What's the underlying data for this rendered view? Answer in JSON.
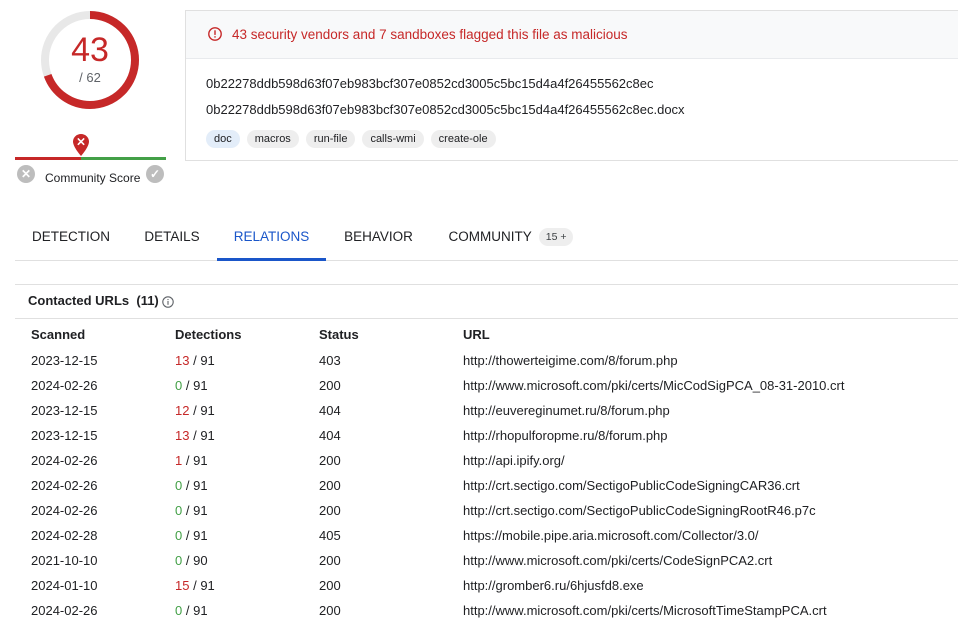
{
  "score": {
    "detections": "43",
    "total": "/ 62"
  },
  "community": {
    "label": "Community Score"
  },
  "summary": {
    "alert": "43 security vendors and 7 sandboxes flagged this file as malicious",
    "hash": "0b22278ddb598d63f07eb983bcf307e0852cd3005c5bc15d4a4f26455562c8ec",
    "filename": "0b22278ddb598d63f07eb983bcf307e0852cd3005c5bc15d4a4f26455562c8ec.docx",
    "tags": [
      "doc",
      "macros",
      "run-file",
      "calls-wmi",
      "create-ole"
    ]
  },
  "tabs": [
    {
      "label": "DETECTION"
    },
    {
      "label": "DETAILS"
    },
    {
      "label": "RELATIONS"
    },
    {
      "label": "BEHAVIOR"
    },
    {
      "label": "COMMUNITY",
      "badge": "15 +"
    }
  ],
  "contacted": {
    "title": "Contacted URLs",
    "count": "(11)",
    "columns": {
      "scanned": "Scanned",
      "detections": "Detections",
      "status": "Status",
      "url": "URL"
    },
    "rows": [
      {
        "scanned": "2023-12-15",
        "det": "13",
        "total": "/ 91",
        "status": "403",
        "url": "http://thowerteigime.com/8/forum.php"
      },
      {
        "scanned": "2024-02-26",
        "det": "0",
        "total": "/ 91",
        "status": "200",
        "url": "http://www.microsoft.com/pki/certs/MicCodSigPCA_08-31-2010.crt"
      },
      {
        "scanned": "2023-12-15",
        "det": "12",
        "total": "/ 91",
        "status": "404",
        "url": "http://euvereginumet.ru/8/forum.php"
      },
      {
        "scanned": "2023-12-15",
        "det": "13",
        "total": "/ 91",
        "status": "404",
        "url": "http://rhopulforopme.ru/8/forum.php"
      },
      {
        "scanned": "2024-02-26",
        "det": "1",
        "total": "/ 91",
        "status": "200",
        "url": "http://api.ipify.org/"
      },
      {
        "scanned": "2024-02-26",
        "det": "0",
        "total": "/ 91",
        "status": "200",
        "url": "http://crt.sectigo.com/SectigoPublicCodeSigningCAR36.crt"
      },
      {
        "scanned": "2024-02-26",
        "det": "0",
        "total": "/ 91",
        "status": "200",
        "url": "http://crt.sectigo.com/SectigoPublicCodeSigningRootR46.p7c"
      },
      {
        "scanned": "2024-02-28",
        "det": "0",
        "total": "/ 91",
        "status": "405",
        "url": "https://mobile.pipe.aria.microsoft.com/Collector/3.0/"
      },
      {
        "scanned": "2021-10-10",
        "det": "0",
        "total": "/ 90",
        "status": "200",
        "url": "http://www.microsoft.com/pki/certs/CodeSignPCA2.crt"
      },
      {
        "scanned": "2024-01-10",
        "det": "15",
        "total": "/ 91",
        "status": "200",
        "url": "http://gromber6.ru/6hjusfd8.exe"
      },
      {
        "scanned": "2024-02-26",
        "det": "0",
        "total": "/ 91",
        "status": "200",
        "url": "http://www.microsoft.com/pki/certs/MicrosoftTimeStampPCA.crt"
      }
    ]
  },
  "colors": {
    "malicious": "#c62828",
    "clean": "#43a047",
    "accent": "#1a56c9"
  }
}
